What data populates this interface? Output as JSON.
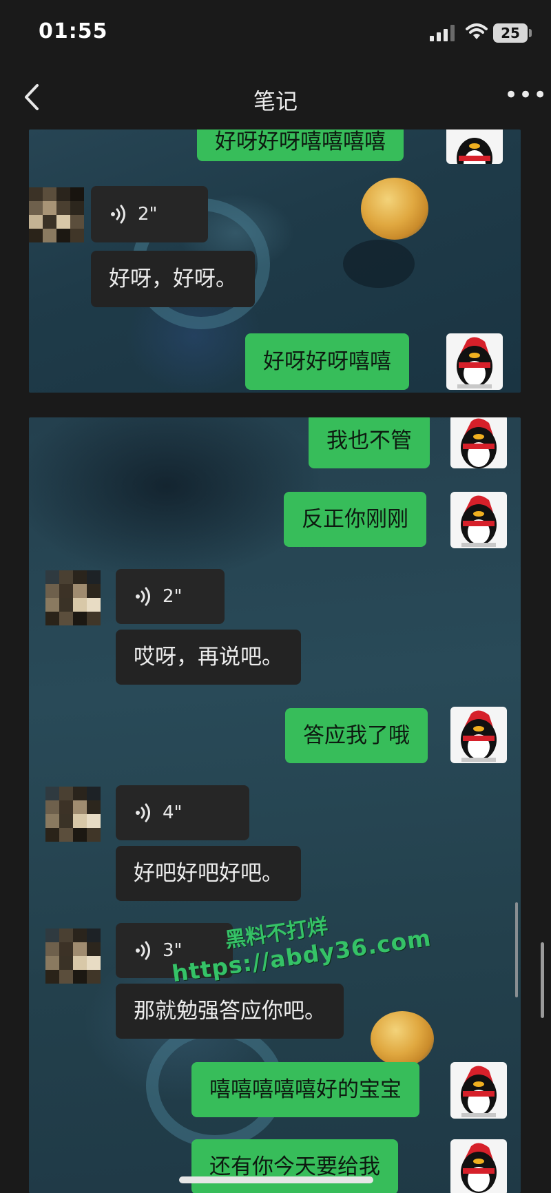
{
  "status_bar": {
    "time": "01:55",
    "battery": "25"
  },
  "nav": {
    "title": "笔记",
    "more": "•••"
  },
  "panel1": {
    "messages": [
      {
        "from": "me",
        "text": "好呀好呀嘻嘻嘻嘻"
      },
      {
        "from": "other",
        "type": "voice",
        "duration": "2\""
      },
      {
        "from": "other",
        "text": "好呀，好呀。"
      },
      {
        "from": "me",
        "text": "好呀好呀嘻嘻"
      }
    ]
  },
  "panel2": {
    "messages": [
      {
        "from": "me",
        "text": "我也不管"
      },
      {
        "from": "me",
        "text": "反正你刚刚"
      },
      {
        "from": "other",
        "type": "voice",
        "duration": "2\""
      },
      {
        "from": "other",
        "text": "哎呀，再说吧。"
      },
      {
        "from": "me",
        "text": "答应我了哦"
      },
      {
        "from": "other",
        "type": "voice",
        "duration": "4\""
      },
      {
        "from": "other",
        "text": "好吧好吧好吧。"
      },
      {
        "from": "other",
        "type": "voice",
        "duration": "3\""
      },
      {
        "from": "other",
        "text": "那就勉强答应你吧。"
      },
      {
        "from": "me",
        "text": "嘻嘻嘻嘻嘻好的宝宝"
      },
      {
        "from": "me",
        "text": "还有你今天要给我"
      }
    ]
  },
  "watermark": {
    "line1": "黑料不打烊",
    "line2": "https://abdy36.com"
  },
  "colors": {
    "green_bubble": "#37bd5a",
    "dark_bubble": "#232323",
    "background": "#1a1a1a"
  },
  "icons": [
    "back-chevron-icon",
    "more-dots-icon",
    "voice-wave-icon",
    "signal-icon",
    "wifi-icon"
  ]
}
